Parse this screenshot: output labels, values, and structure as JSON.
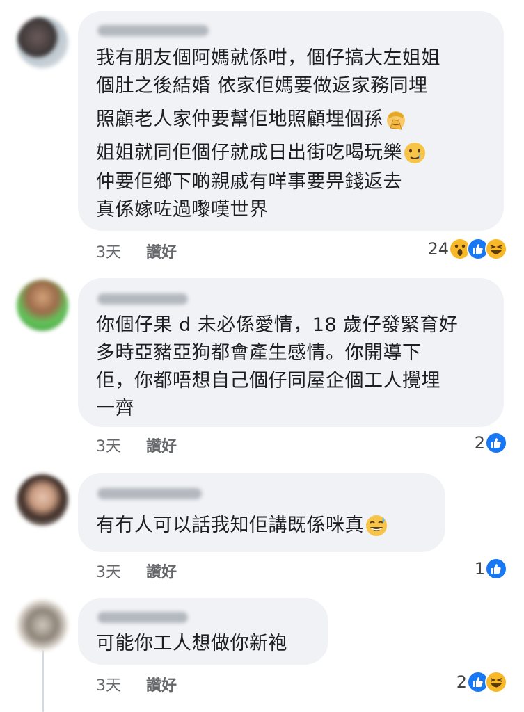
{
  "comments": [
    {
      "lines": [
        "我有朋友個阿媽就係咁，個仔搞大左姐姐",
        "個肚之後結婚 依家佢媽要做返家務同埋",
        "照顧老人家仲要幫佢地照顧埋個孫",
        "姐姐就同佢個仔就成日出街吃喝玩樂",
        "仲要佢鄉下啲親戚有咩事要畀錢返去",
        "真係嫁咗過嚟嘆世界"
      ],
      "inline_emojis": [
        "facepalm-emoji",
        "tearful-smile-emoji"
      ],
      "time": "3天",
      "like_label": "讚好",
      "reaction_count": "24",
      "reactions": [
        "wow",
        "like",
        "haha"
      ]
    },
    {
      "lines": [
        "你個仔果 d 未必係愛情，18 歲仔發緊育好",
        "多時亞豬亞狗都會產生感情。你開導下",
        "佢，你都唔想自己個仔同屋企個工人攪埋",
        "一齊"
      ],
      "time": "3天",
      "like_label": "讚好",
      "reaction_count": "2",
      "reactions": [
        "like"
      ]
    },
    {
      "lines": [
        "有冇人可以話我知佢講既係咪真"
      ],
      "inline_emojis": [
        "sweat-smile-emoji"
      ],
      "time": "3天",
      "like_label": "讚好",
      "reaction_count": "1",
      "reactions": [
        "like"
      ]
    },
    {
      "lines": [
        "可能你工人想做你新袍"
      ],
      "time": "3天",
      "like_label": "讚好",
      "reaction_count": "2",
      "reactions": [
        "like",
        "haha"
      ]
    }
  ],
  "colors": {
    "bubble": "#f0f2f5",
    "like_blue": "#1877f2",
    "reaction_yellow": "#f7b928",
    "meta_gray": "#65676b"
  }
}
